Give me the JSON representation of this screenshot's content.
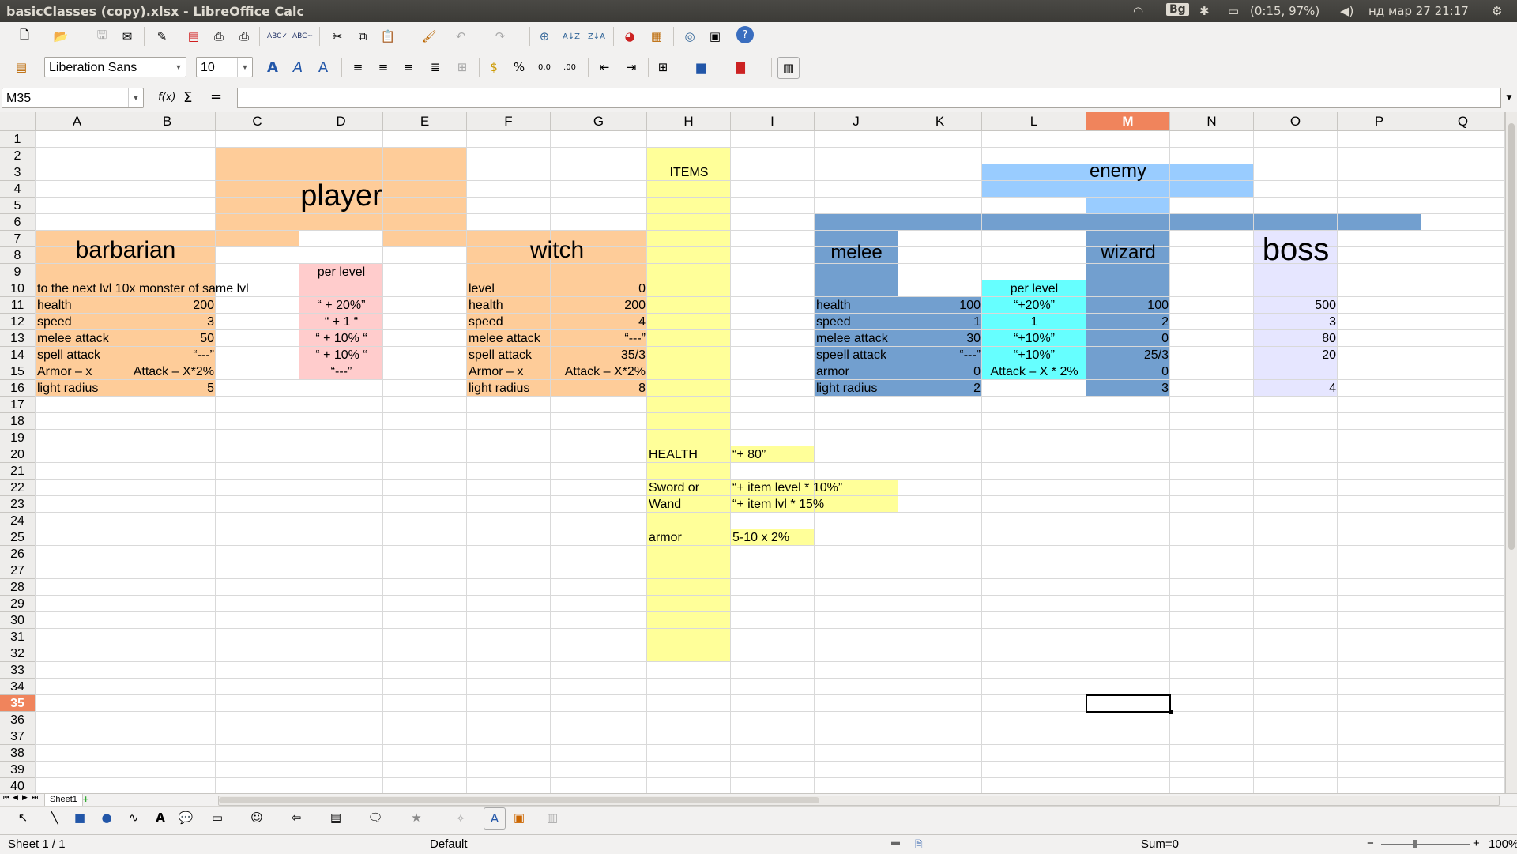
{
  "window": {
    "title": "basicClasses (copy).xlsx - LibreOffice Calc"
  },
  "tray": {
    "keyboard": "Bg",
    "battery": "(0:15, 97%)",
    "clock": "нд мар 27 21:17"
  },
  "format": {
    "font_name": "Liberation Sans",
    "font_size": "10"
  },
  "formula_bar": {
    "name_box": "M35",
    "fx": "f(x)",
    "sigma": "Σ",
    "equals": "=",
    "content": ""
  },
  "columns": [
    "A",
    "B",
    "C",
    "D",
    "E",
    "F",
    "G",
    "H",
    "I",
    "J",
    "K",
    "L",
    "M",
    "N",
    "O",
    "P",
    "Q"
  ],
  "rows": [
    "1",
    "2",
    "3",
    "4",
    "5",
    "6",
    "7",
    "8",
    "9",
    "10",
    "11",
    "12",
    "13",
    "14",
    "15",
    "16",
    "17",
    "18",
    "19",
    "20",
    "21",
    "22",
    "23",
    "24",
    "25",
    "26",
    "27",
    "28",
    "29",
    "30",
    "31",
    "32",
    "33",
    "34",
    "35",
    "36",
    "37",
    "38",
    "39",
    "40"
  ],
  "selected_cell": {
    "col": "M",
    "row": "35"
  },
  "cells": {
    "player": "player",
    "items": "ITEMS",
    "enemy": "enemy",
    "barbarian": "barbarian",
    "witch": "witch",
    "melee": "melee",
    "wizard": "wizard",
    "boss": "boss",
    "per_level": "per level",
    "a10": "to the next lvl 10x monster of same lvl",
    "a11": "health",
    "b11": "200",
    "a12": "speed",
    "b12": "3",
    "a13": "melee attack",
    "b13": "50",
    "a14": "spell attack",
    "b14": "“---”",
    "a15": "Armor – x",
    "b15": "Attack – X*2%",
    "a16": "light radius",
    "b16": "5",
    "d11": "“ + 20%”",
    "d12": "“ + 1 “",
    "d13": "“ + 10% “",
    "d14": "“ + 10% “",
    "d15": "“---”",
    "f10": "level",
    "g10": "0",
    "f11": "health",
    "g11": "200",
    "f12": "speed",
    "g12": "4",
    "f13": "melee attack",
    "g13": "“---”",
    "f14": "spell attack",
    "g14": "35/3",
    "f15": "Armor – x",
    "g15": "Attack – X*2%",
    "f16": "light radius",
    "g16": "8",
    "j11": "health",
    "k11": "100",
    "j12": "speed",
    "k12": "1",
    "j13": "melee attack",
    "k13": "30",
    "j14": "speell attack",
    "k14": "“---”",
    "j15": "armor",
    "k15": "0",
    "j16": "light radius",
    "k16": "2",
    "l10": "per level",
    "l11": "“+20%”",
    "l12": "1",
    "l13": "“+10%”",
    "l14": "“+10%”",
    "l15": "Attack – X * 2%",
    "m11": "100",
    "m12": "2",
    "m13": "0",
    "m14": "25/3",
    "m15": "0",
    "m16": "3",
    "o11": "500",
    "o12": "3",
    "o13": "80",
    "o14": "20",
    "o16": "4",
    "h20": "HEALTH",
    "i20": "“+ 80”",
    "h22": "Sword or",
    "i22": "“+ item level * 10%”",
    "h23": "Wand",
    "i23": "“+ item lvl * 15%",
    "h25": "armor",
    "i25": "5-10 x 2%"
  },
  "tabs": {
    "sheet1": "Sheet1"
  },
  "status": {
    "sheet": "Sheet 1 / 1",
    "style": "Default",
    "sum": "Sum=0",
    "zoom": "100%"
  },
  "colors": {
    "orange": "#fecc99",
    "pink": "#ffcccc",
    "yellow": "#ffff99",
    "lightblue": "#99ccff",
    "steelblue": "#729fcf",
    "cyan": "#66ffff",
    "lavender": "#e6e6ff",
    "highlight": "#f0845c"
  }
}
